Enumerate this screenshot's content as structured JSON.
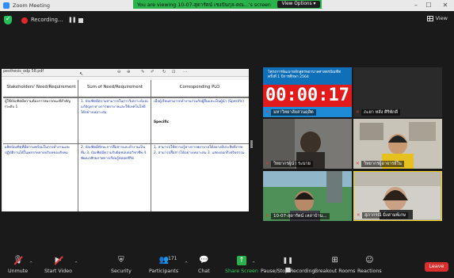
{
  "window": {
    "title": "Zoom Meeting",
    "controls": {
      "minimize": "–",
      "maximize": "☐",
      "close": "✕"
    }
  },
  "share_banner": {
    "message": "You are viewing 10-07-สุดารัตน์ เชงปันกุล-คณ...'s screen",
    "options_label": "View Options ▾"
  },
  "top_toolbar": {
    "recording_label": "Recording...",
    "pause_glyph": "❚❚",
    "view_label": "View"
  },
  "shared_screen": {
    "file_name": "pesthesis_odp 58.pdf",
    "table": {
      "headers": [
        "Stakeholders' Need/Requirement",
        "Sum of Need/Requirement",
        "Corresponding PLO"
      ],
      "rows": [
        {
          "col1": "ผู้ใช้บัณฑิตมีความต้องการสมรรถนะที่สำคัญ (ระดับ 1",
          "col2": "1. บัณฑิตมีความสามารถในการวิเคราะห์และแก้ปัญหาทางการพยาบาลและใช้เทคโนโลยีได้อย่างเหมาะสม",
          "col3": "เมื่อผู้เรียนสามารถทำงานร่วมกับผู้อื่นและเป็นผู้นำ (Specific)"
        },
        {
          "col1": "ผลิตบัณฑิตที่มีความพร้อมในการทำงานและปฏิบัติงานได้ในหลากหลายบริบทของสังคม",
          "col2": "2. บัณฑิตมีทักษะการสื่อสารและทำงานเป็นทีม 3. บัณฑิตมีความรับผิดชอบต่อวิชาชีพ 4. พัฒนาศักยภาพการเรียนรู้ตลอดชีวิต",
          "col3": "1. สามารถใช้ความรู้ทางการพยาบาลได้อย่างมีประสิทธิภาพ 2. สามารถสื่อสารได้อย่างเหมาะสม 3. แสดงออกถึงจริยธรรม"
        }
      ],
      "specific_label": "Specific"
    }
  },
  "gallery": {
    "tiles": [
      {
        "id": "t1",
        "name": "มหาวิทยาลัยสวนดุสิต",
        "timer": "00:00:17",
        "banner_text": "โครงการพัฒนาหลักสูตรพยาบาลศาสตรบัณฑิต ครั้งที่ 1 ปีการศึกษา 2564"
      },
      {
        "id": "t2",
        "name": "ภะยา หลัง ศิริพักดี"
      },
      {
        "id": "t3",
        "name": "วิทยากรผู้นำ ระบาย"
      },
      {
        "id": "t4",
        "name": "วิทยากรผู้อาจารย์ใน"
      },
      {
        "id": "t5",
        "name": "10-07-สุดารัตน์ เหล่าบ้าน..."
      },
      {
        "id": "t6",
        "name": "สุภากรณี มิ่งสามพ์เกษ"
      }
    ]
  },
  "bottom_toolbar": {
    "buttons": [
      {
        "key": "unmute",
        "label": "Unmute"
      },
      {
        "key": "start_video",
        "label": "Start Video"
      },
      {
        "key": "security",
        "label": "Security"
      },
      {
        "key": "participants",
        "label": "Participants",
        "count": "171"
      },
      {
        "key": "chat",
        "label": "Chat"
      },
      {
        "key": "share_screen",
        "label": "Share Screen"
      },
      {
        "key": "pause_stop_recording",
        "label": "Pause/Stop Recording"
      },
      {
        "key": "breakout_rooms",
        "label": "Breakout Rooms"
      },
      {
        "key": "reactions",
        "label": "Reactions"
      }
    ],
    "leave_label": "Leave"
  },
  "colors": {
    "accent_green": "#29b34a",
    "timer_red": "#e11b1b",
    "leave_red": "#d92f2f",
    "active_speaker": "#f2d21b"
  }
}
